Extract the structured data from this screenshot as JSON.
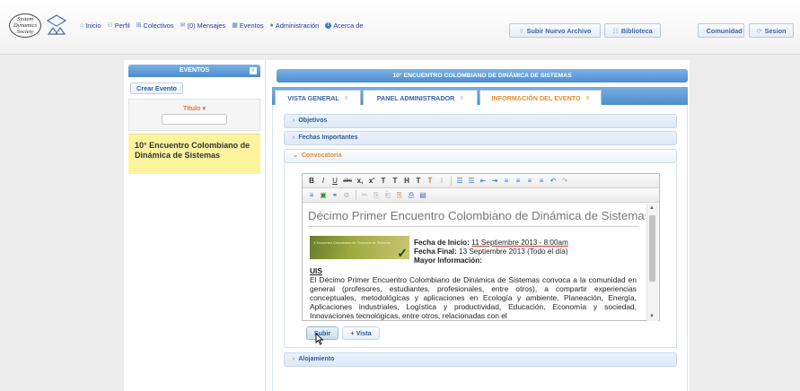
{
  "logo": {
    "text": "System Dynamics Society"
  },
  "nav": [
    {
      "label": "Inicio",
      "icon": "home-icon",
      "glyph": "⌂"
    },
    {
      "label": "Perfil",
      "icon": "user-icon",
      "glyph": "⚇"
    },
    {
      "label": "Colectivos",
      "icon": "group-icon",
      "glyph": "⊞"
    },
    {
      "label": "(0) Mensajes",
      "icon": "mail-icon",
      "glyph": "✉"
    },
    {
      "label": "Eventos",
      "icon": "calendar-icon",
      "glyph": "▦"
    },
    {
      "label": "Administración",
      "icon": "admin-icon",
      "glyph": "●"
    },
    {
      "label": "Acerca de",
      "icon": "info-icon",
      "glyph": "i"
    }
  ],
  "top_buttons": {
    "upload": "Subir Nuevo Archivo",
    "library": "Biblioteca",
    "community": "Comunidad",
    "session": "Sesion"
  },
  "sidebar": {
    "header": "EVENTOS",
    "collapse_glyph": "‹",
    "create_button": "Crear Evento",
    "title_filter_label": "Titulo",
    "event_item": "10° Encuentro Colombiano de Dinámica de Sistemas"
  },
  "event": {
    "header": "10° ENCUENTRO COLOMBIANO DE DINÁMICA DE SISTEMAS",
    "tabs": [
      {
        "label": "VISTA GENERAL",
        "close": "x",
        "active": false
      },
      {
        "label": "PANEL ADMINISTRADOR",
        "close": "x",
        "active": false
      },
      {
        "label": "INFORMACIÓN DEL EVENTO",
        "close": "x",
        "active": true
      }
    ],
    "sections": {
      "objetivos": "Objetivos",
      "fechas": "Fechas Importantes",
      "convocatoria": "Convocatoria",
      "alojamiento": "Alojamiento"
    }
  },
  "editor": {
    "toolbar1": [
      "B",
      "I",
      "U",
      "abc",
      "x,",
      "x'",
      "T",
      "T",
      "H",
      "T",
      "T",
      "I",
      "☰",
      "☰",
      "⇤",
      "⇥",
      "≡",
      "≡",
      "≡",
      "≡",
      "↶",
      "↷"
    ],
    "toolbar2": [
      "≡",
      "▣",
      "⚭",
      "⊘",
      "✂",
      "⎘",
      "⎗",
      "⎘",
      "⎙",
      "▤"
    ],
    "doc_title": "Décimo Primer Encuentro Colombiano de Dinámica de Sistemas",
    "banner_text": "X Encuentro Colombiano de Dinámica de Sistemas",
    "fecha_inicio_label": "Fecha de Inicio:",
    "fecha_inicio_value": "11 Septiembre 2013 - 8:00am",
    "fecha_final_label": "Fecha Final:",
    "fecha_final_value": "13 Septiembre 2013 (Todo el día)",
    "mayor_info": "Mayor Información:",
    "uis": "UIS",
    "body": "El Décimo Primer Encuentro Colombiano de Dinámica de Sistemas convoca a la comunidad en general (profesores, estudiantes, profesionales, entre otros), a compartir experiencias conceptuales, metodológicas y aplicaciones en Ecología y ambiente, Planeación, Energía, Aplicaciones industriales, Logística y productividad, Educación, Economía y sociedad, Innovaciones tecnológicas, entre otros, relacionadas con el"
  },
  "actions": {
    "subir": "Subir",
    "vista": "+ Vista"
  }
}
